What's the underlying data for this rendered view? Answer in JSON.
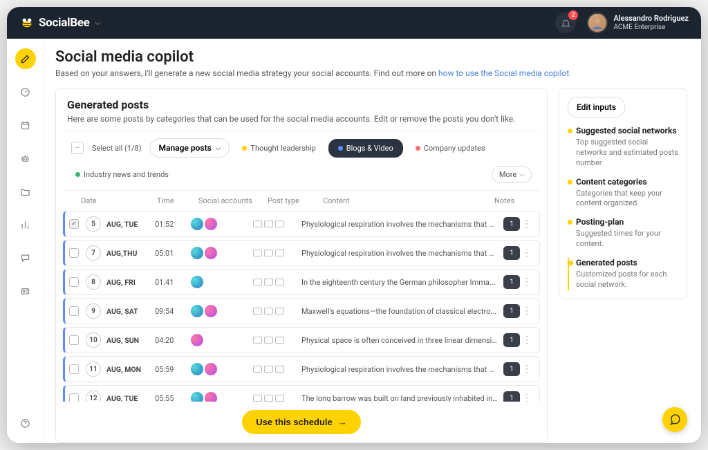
{
  "brand": {
    "name": "SocialBee"
  },
  "header": {
    "notification_count": "2",
    "user_name": "Alessandro Rodriguez",
    "user_org": "ACME Enterprise"
  },
  "page": {
    "title": "Social media copilot",
    "subtitle_prefix": "Based on your answers, I'll generate a new social media strategy  your social accounts. Find out more on ",
    "subtitle_link": "how to use the Social media copilot"
  },
  "panel": {
    "title": "Generated posts",
    "desc": "Here are some posts by categories that can be used for the social media accounts. Edit or remove the posts you don't like.",
    "select_all_label": "Select all (1/8)",
    "manage_label": "Manage posts",
    "more_label": "More"
  },
  "filters": [
    {
      "label": "Thought leadership",
      "dot": "#ffd200",
      "active": false
    },
    {
      "label": "Blogs & Video",
      "dot": "#5a8bff",
      "active": true
    },
    {
      "label": "Company updates",
      "dot": "#ff6b6b",
      "active": false
    },
    {
      "label": "Industry news and trends",
      "dot": "#2fb66b",
      "active": false
    }
  ],
  "columns": {
    "date": "Date",
    "time": "Time",
    "accounts": "Social accounts",
    "post_type": "Post type",
    "content": "Content",
    "notes": "Notes"
  },
  "rows": [
    {
      "checked": true,
      "day": "5",
      "month": "AUG, TUE",
      "time": "01:52",
      "accounts": [
        "a",
        "b"
      ],
      "content": "Physiological respiration involves the mechanisms that e...",
      "notes": "1"
    },
    {
      "checked": false,
      "day": "7",
      "month": "AUG,THU",
      "time": "05:01",
      "accounts": [
        "a",
        "b"
      ],
      "content": "Physiological respiration involves the mechanisms that e...",
      "notes": "1"
    },
    {
      "checked": false,
      "day": "8",
      "month": "AUG, FRI",
      "time": "01:41",
      "accounts": [
        "a"
      ],
      "content": "In the eighteenth century the German philosopher Imma...",
      "notes": "1"
    },
    {
      "checked": false,
      "day": "9",
      "month": "AUG, SAT",
      "time": "09:54",
      "accounts": [
        "a",
        "b"
      ],
      "content": "Maxwell's equations—the foundation of classical electro...",
      "notes": "1"
    },
    {
      "checked": false,
      "day": "10",
      "month": "AUG, SUN",
      "time": "04:20",
      "accounts": [
        "b"
      ],
      "content": "Physical space is often conceived in three linear dimensio...",
      "notes": "1"
    },
    {
      "checked": false,
      "day": "11",
      "month": "AUG, MON",
      "time": "05:59",
      "accounts": [
        "a",
        "b"
      ],
      "content": "Physiological respiration involves the mechanisms that e...",
      "notes": "1"
    },
    {
      "checked": false,
      "day": "12",
      "month": "AUG, TUE",
      "time": "05:55",
      "accounts": [
        "a",
        "b"
      ],
      "content": "The long barrow was built on land previously inhabited in...",
      "notes": "1"
    }
  ],
  "cta": {
    "label": "Use this schedule"
  },
  "side": {
    "edit_inputs": "Edit inputs",
    "items": [
      {
        "title": "Suggested social networks",
        "desc": "Top suggested social networks and estimated posts number"
      },
      {
        "title": "Content categories",
        "desc": "Categories that keep your content organized."
      },
      {
        "title": "Posting-plan",
        "desc": "Suggested times for your content."
      },
      {
        "title": "Generated posts",
        "desc": "Customized posts for each social network."
      }
    ],
    "active_index": 3
  }
}
